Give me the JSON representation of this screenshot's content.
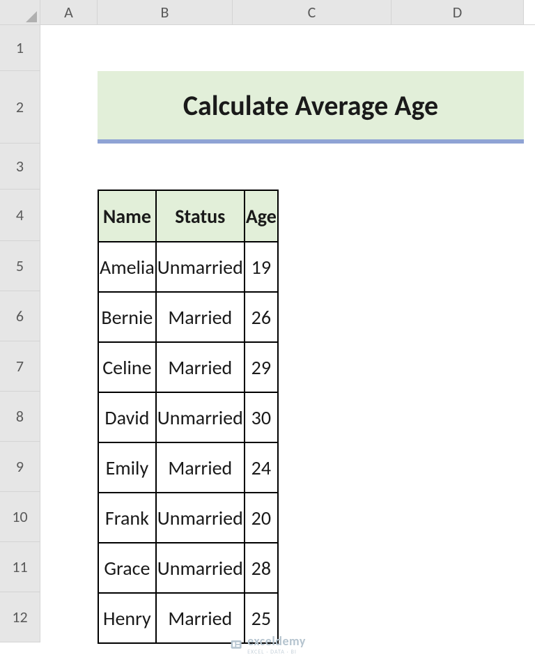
{
  "columns": [
    "A",
    "B",
    "C",
    "D"
  ],
  "row_numbers": [
    "1",
    "2",
    "3",
    "4",
    "5",
    "6",
    "7",
    "8",
    "9",
    "10",
    "11",
    "12"
  ],
  "title": "Calculate Average Age",
  "headers": {
    "name": "Name",
    "status": "Status",
    "age": "Age"
  },
  "rows": [
    {
      "name": "Amelia",
      "status": "Unmarried",
      "age": "19"
    },
    {
      "name": "Bernie",
      "status": "Married",
      "age": "26"
    },
    {
      "name": "Celine",
      "status": "Married",
      "age": "29"
    },
    {
      "name": "David",
      "status": "Unmarried",
      "age": "30"
    },
    {
      "name": "Emily",
      "status": "Married",
      "age": "24"
    },
    {
      "name": "Frank",
      "status": "Unmarried",
      "age": "20"
    },
    {
      "name": "Grace",
      "status": "Unmarried",
      "age": "28"
    },
    {
      "name": "Henry",
      "status": "Married",
      "age": "25"
    }
  ],
  "watermark": {
    "brand": "exceldemy",
    "tagline": "EXCEL · DATA · BI"
  }
}
